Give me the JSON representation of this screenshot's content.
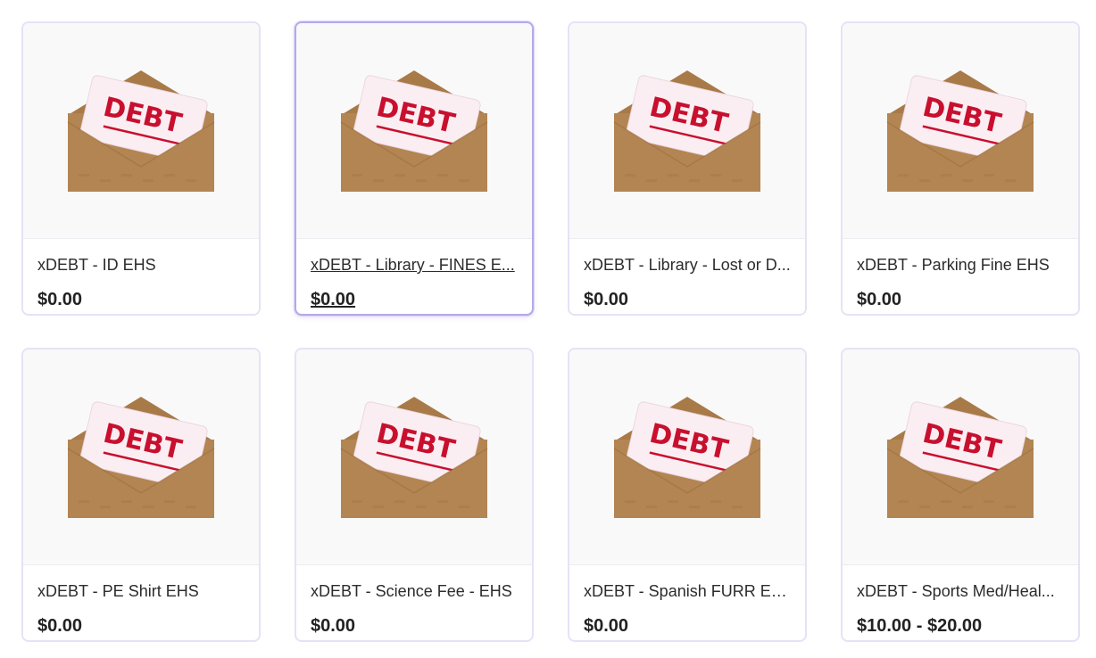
{
  "brand_colors": {
    "card_border": "#e6e2f6",
    "card_border_hover": "#b5a9ea",
    "debt_red": "#c8102e",
    "envelope_brown": "#b38552"
  },
  "products": [
    {
      "name": "xDEBT - ID EHS",
      "price": "$0.00",
      "image": {
        "icon": "debt-envelope-icon",
        "text": "DEBT"
      }
    },
    {
      "name": "xDEBT - Library - FINES E...",
      "price": "$0.00",
      "image": {
        "icon": "debt-envelope-icon",
        "text": "DEBT"
      }
    },
    {
      "name": "xDEBT - Library - Lost or D...",
      "price": "$0.00",
      "image": {
        "icon": "debt-envelope-icon",
        "text": "DEBT"
      }
    },
    {
      "name": "xDEBT - Parking Fine EHS",
      "price": "$0.00",
      "image": {
        "icon": "debt-envelope-icon",
        "text": "DEBT"
      }
    },
    {
      "name": "xDEBT - PE Shirt EHS",
      "price": "$0.00",
      "image": {
        "icon": "debt-envelope-icon",
        "text": "DEBT"
      }
    },
    {
      "name": "xDEBT - Science Fee - EHS",
      "price": "$0.00",
      "image": {
        "icon": "debt-envelope-icon",
        "text": "DEBT"
      }
    },
    {
      "name": "xDEBT - Spanish FURR EHS",
      "price": "$0.00",
      "image": {
        "icon": "debt-envelope-icon",
        "text": "DEBT"
      }
    },
    {
      "name": "xDEBT - Sports Med/Heal...",
      "price": "$10.00 - $20.00",
      "image": {
        "icon": "debt-envelope-icon",
        "text": "DEBT"
      }
    }
  ]
}
